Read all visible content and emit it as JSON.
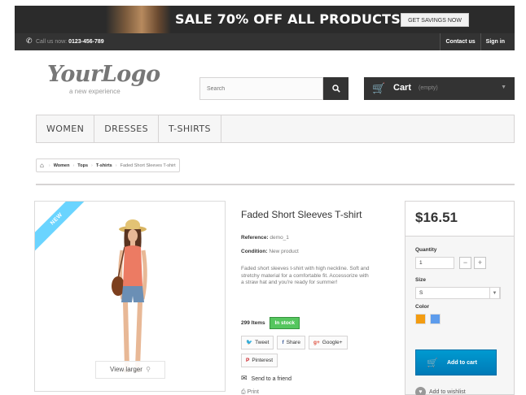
{
  "banner": {
    "promo_text": "SALE 70% OFF ALL PRODUCTS",
    "promo_button": "GET SAVINGS NOW"
  },
  "utility_bar": {
    "phone_prefix": "Call us now:",
    "phone_number": "0123-456-789",
    "links": [
      "Contact us",
      "Sign in"
    ]
  },
  "header": {
    "logo_main": "YourLogo",
    "logo_sub": "a new experience",
    "search_placeholder": "Search",
    "cart_label": "Cart",
    "cart_status": "(empty)"
  },
  "nav": {
    "items": [
      "WOMEN",
      "DRESSES",
      "T-SHIRTS"
    ]
  },
  "breadcrumb": {
    "items": [
      "Women",
      "Tops",
      "T-shirts"
    ],
    "current": "Faded Short Sleeves T-shirt"
  },
  "product": {
    "ribbon": "NEW",
    "view_larger": "View larger",
    "title": "Faded Short Sleeves T-shirt",
    "reference_label": "Reference:",
    "reference_value": "demo_1",
    "condition_label": "Condition:",
    "condition_value": "New product",
    "description": "Faded short sleeves t-shirt with high neckline. Soft and stretchy material for a comfortable fit. Accessorize with a straw hat and you're ready for summer!",
    "stock_count": "299 Items",
    "stock_status": "In stock",
    "social": [
      {
        "icon": "twitter-icon",
        "glyph": "🐦",
        "label": "Tweet"
      },
      {
        "icon": "facebook-icon",
        "glyph": "f",
        "label": "Share"
      },
      {
        "icon": "google-plus-icon",
        "glyph": "g+",
        "label": "Google+"
      },
      {
        "icon": "pinterest-icon",
        "glyph": "P",
        "label": "Pinterest"
      }
    ],
    "send_friend": "Send to a friend",
    "print": "Print"
  },
  "buy_box": {
    "price": "$16.51",
    "quantity_label": "Quantity",
    "quantity_value": "1",
    "size_label": "Size",
    "size_value": "S",
    "color_label": "Color",
    "colors": [
      "#f39c11",
      "#5d9cec"
    ],
    "add_to_cart": "Add to cart",
    "wishlist": "Add to wishlist"
  }
}
